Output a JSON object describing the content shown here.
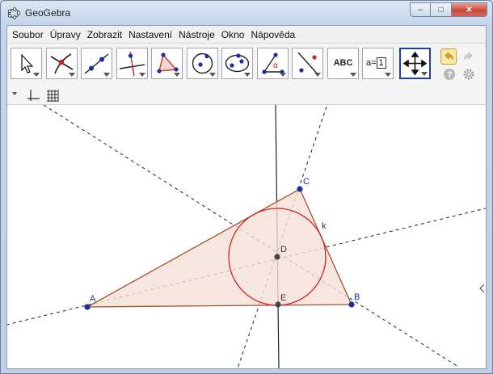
{
  "window": {
    "title": "GeoGebra",
    "minimize": "–",
    "maximize": "□",
    "close": "✕"
  },
  "menu": [
    "Soubor",
    "Úpravy",
    "Zobrazit",
    "Nastavení",
    "Nástroje",
    "Okno",
    "Nápověda"
  ],
  "toolbar": {
    "tools": [
      {
        "name": "move-tool",
        "icon": "cursor-arrow-icon"
      },
      {
        "name": "point-tool",
        "icon": "intersect-point-icon"
      },
      {
        "name": "line-tool",
        "icon": "line-through-points-icon"
      },
      {
        "name": "perpendicular-tool",
        "icon": "perpendicular-line-icon"
      },
      {
        "name": "polygon-tool",
        "icon": "polygon-icon"
      },
      {
        "name": "circle-tool",
        "icon": "circle-center-point-icon"
      },
      {
        "name": "conic-tool",
        "icon": "ellipse-icon"
      },
      {
        "name": "angle-tool",
        "icon": "angle-icon"
      },
      {
        "name": "reflect-tool",
        "icon": "reflect-about-line-icon"
      },
      {
        "name": "text-tool",
        "icon": "text-icon",
        "label": "ABC"
      },
      {
        "name": "slider-tool",
        "icon": "slider-icon",
        "label": "a=",
        "value": "1"
      },
      {
        "name": "move-view-tool",
        "icon": "move-graphics-view-icon",
        "selected": true
      }
    ],
    "undo_icon": "undo-icon",
    "redo_icon": "redo-icon",
    "help_icon": "help-icon",
    "settings_icon": "gear-icon"
  },
  "stylebar": {
    "toggle_icon": "triangle-down-icon",
    "axes_icon": "axes-icon",
    "grid_icon": "grid-icon"
  },
  "construction": {
    "points": {
      "A": {
        "label": "A"
      },
      "B": {
        "label": "B"
      },
      "C": {
        "label": "C"
      },
      "D": {
        "label": "D"
      },
      "E": {
        "label": "E"
      }
    },
    "circle_label": "k",
    "colors": {
      "triangle_fill": "#f5e0d8",
      "triangle_stroke": "#a0522d",
      "circle": "#d42020",
      "free_point": "#1a2e9c",
      "dependent_point": "#444444"
    }
  }
}
